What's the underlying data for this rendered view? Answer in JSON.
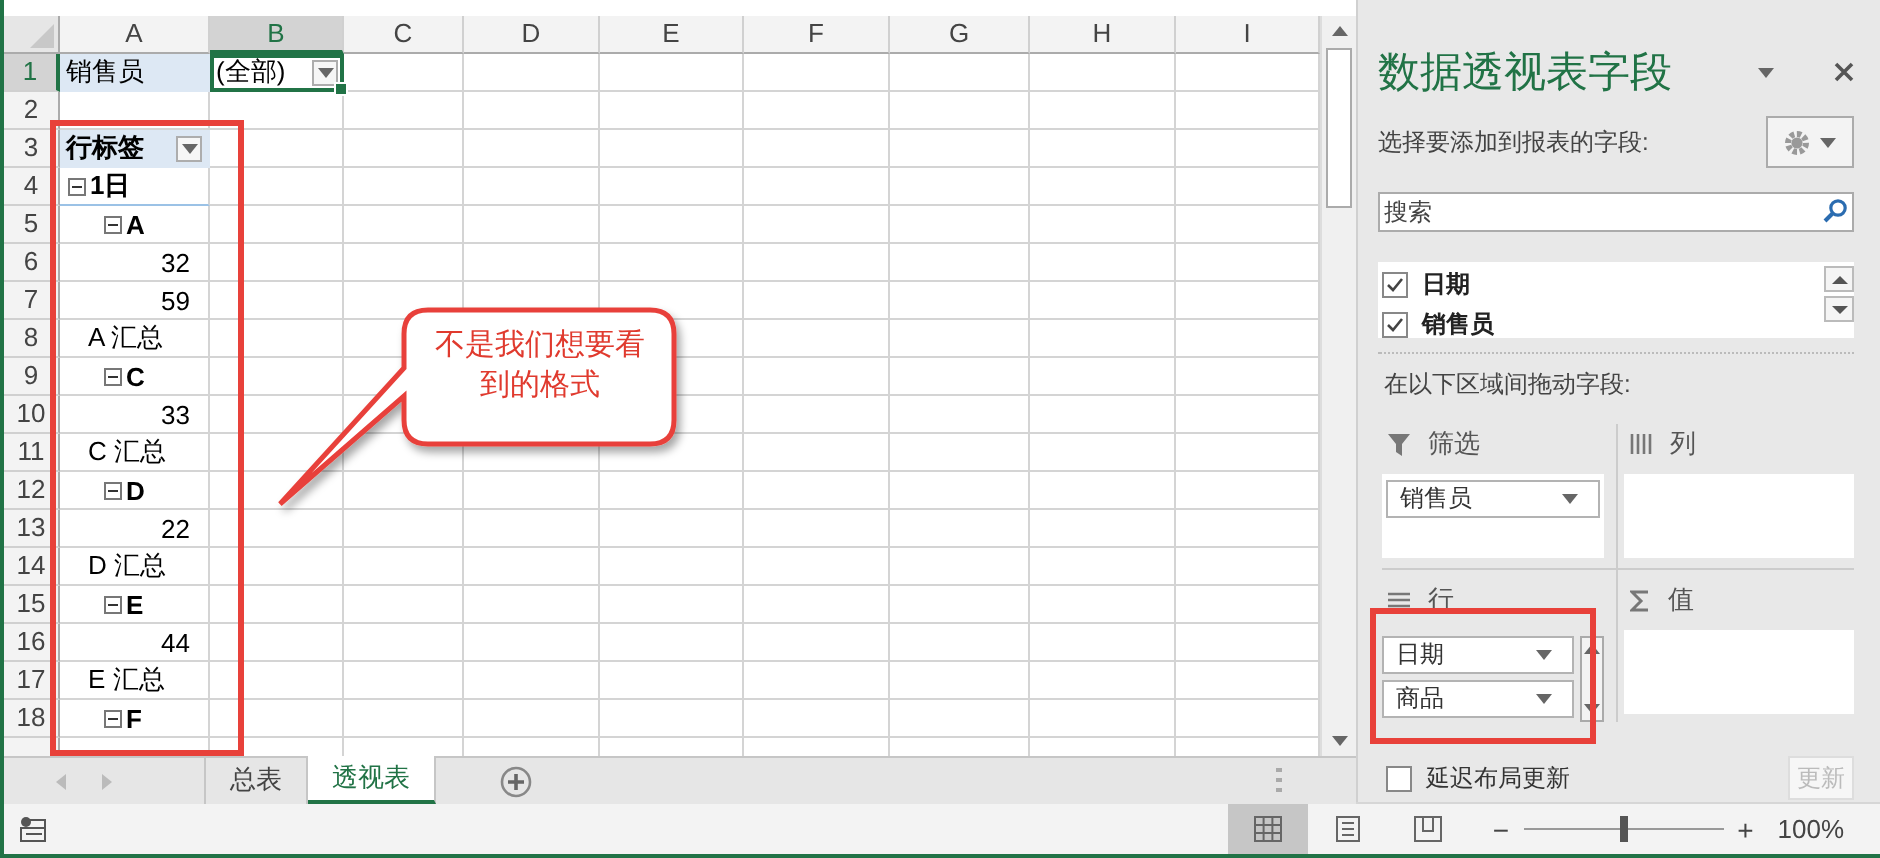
{
  "sheet": {
    "column_headers": [
      {
        "label": "A",
        "selected": false
      },
      {
        "label": "B",
        "selected": true
      },
      {
        "label": "C",
        "selected": false
      },
      {
        "label": "D",
        "selected": false
      },
      {
        "label": "E",
        "selected": false
      },
      {
        "label": "F",
        "selected": false
      },
      {
        "label": "G",
        "selected": false
      },
      {
        "label": "H",
        "selected": false
      },
      {
        "label": "I",
        "selected": false
      }
    ],
    "rows": [
      {
        "number": "1",
        "selected": true,
        "cells": [
          {
            "kind": "field",
            "text": "销售员",
            "selected": false
          },
          {
            "kind": "filter",
            "text": "(全部)",
            "selected": true
          }
        ]
      },
      {
        "number": "2",
        "selected": false
      },
      {
        "number": "3",
        "selected": false,
        "cells": [
          {
            "kind": "header",
            "text": "行标签",
            "selected": false
          }
        ]
      },
      {
        "number": "4",
        "selected": false,
        "cells": [
          {
            "kind": "date",
            "text": "1日",
            "expanded": true,
            "selected": false
          }
        ]
      },
      {
        "number": "5",
        "selected": false,
        "cells": [
          {
            "kind": "item",
            "text": "A",
            "expanded": true,
            "selected": false
          }
        ]
      },
      {
        "number": "6",
        "selected": false,
        "cells": [
          {
            "kind": "value",
            "text": "32",
            "selected": false
          }
        ]
      },
      {
        "number": "7",
        "selected": false,
        "cells": [
          {
            "kind": "value",
            "text": "59",
            "selected": false
          }
        ]
      },
      {
        "number": "8",
        "selected": false,
        "cells": [
          {
            "kind": "subtotal",
            "text": "A 汇总",
            "selected": false
          }
        ]
      },
      {
        "number": "9",
        "selected": false,
        "cells": [
          {
            "kind": "item",
            "text": "C",
            "expanded": true,
            "selected": false
          }
        ]
      },
      {
        "number": "10",
        "selected": false,
        "cells": [
          {
            "kind": "value",
            "text": "33",
            "selected": false
          }
        ]
      },
      {
        "number": "11",
        "selected": false,
        "cells": [
          {
            "kind": "subtotal",
            "text": "C 汇总",
            "selected": false
          }
        ]
      },
      {
        "number": "12",
        "selected": false,
        "cells": [
          {
            "kind": "item",
            "text": "D",
            "expanded": true,
            "selected": false
          }
        ]
      },
      {
        "number": "13",
        "selected": false,
        "cells": [
          {
            "kind": "value",
            "text": "22",
            "selected": false
          }
        ]
      },
      {
        "number": "14",
        "selected": false,
        "cells": [
          {
            "kind": "subtotal",
            "text": "D 汇总",
            "selected": false
          }
        ]
      },
      {
        "number": "15",
        "selected": false,
        "cells": [
          {
            "kind": "item",
            "text": "E",
            "expanded": true,
            "selected": false
          }
        ]
      },
      {
        "number": "16",
        "selected": false,
        "cells": [
          {
            "kind": "value",
            "text": "44",
            "selected": false
          }
        ]
      },
      {
        "number": "17",
        "selected": false,
        "cells": [
          {
            "kind": "subtotal",
            "text": "E 汇总",
            "selected": false
          }
        ]
      },
      {
        "number": "18",
        "selected": false,
        "cells": [
          {
            "kind": "item",
            "text": "F",
            "expanded": true,
            "selected": false
          }
        ]
      }
    ],
    "callout": {
      "text": "不是我们想要看到的格式"
    },
    "sheet_tabs": [
      {
        "label": "总表",
        "selected": false
      },
      {
        "label": "透视表",
        "selected": true
      }
    ]
  },
  "pane": {
    "title": "数据透视表字段",
    "choose_label": "选择要添加到报表的字段:",
    "search": {
      "placeholder": "搜索"
    },
    "fields": [
      {
        "label": "日期",
        "checked": true
      },
      {
        "label": "销售员",
        "checked": true
      }
    ],
    "drag_label": "在以下区域间拖动字段:",
    "areas": [
      {
        "kind": "filters",
        "label": "筛选",
        "items": [
          {
            "label": "销售员"
          }
        ]
      },
      {
        "kind": "columns",
        "label": "列"
      },
      {
        "kind": "rows",
        "label": "行",
        "items": [
          {
            "label": "日期"
          },
          {
            "label": "商品"
          }
        ]
      },
      {
        "kind": "values",
        "label": "值"
      }
    ],
    "defer_update": {
      "label": "延迟布局更新",
      "checked": false
    },
    "update_button": {
      "label": "更新",
      "disabled": true
    }
  },
  "status_bar": {
    "views": [
      {
        "kind": "normal",
        "selected": true
      },
      {
        "kind": "page-layout",
        "selected": false
      },
      {
        "kind": "page-break",
        "selected": false
      }
    ],
    "zoom_out": "−",
    "zoom_slider": {
      "level": 0.5
    },
    "zoom_in": "+",
    "zoom": "100%"
  }
}
